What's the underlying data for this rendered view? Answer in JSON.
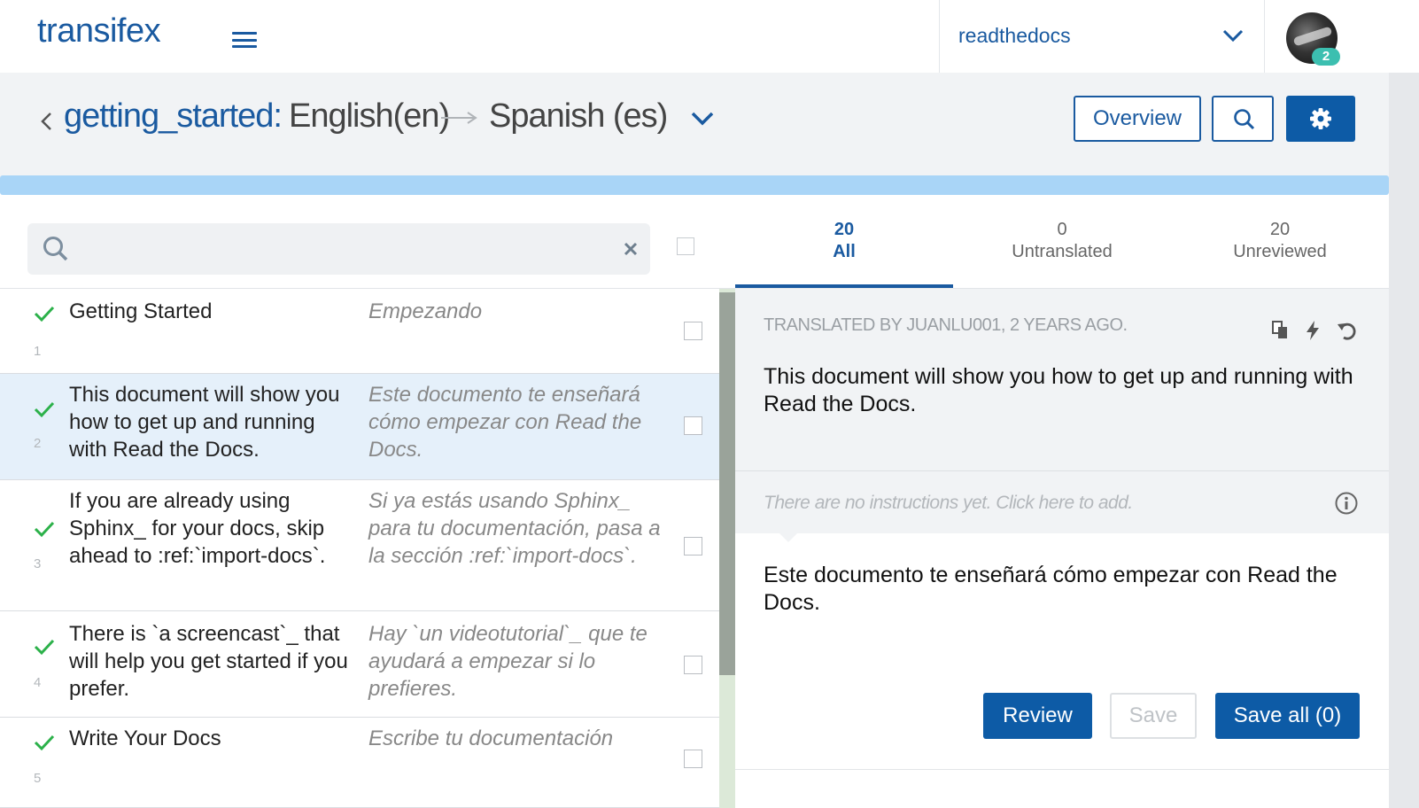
{
  "app": {
    "logo_text": "transifex"
  },
  "topbar": {
    "organization": "readthedocs",
    "notification_count": "2"
  },
  "header": {
    "project": "getting_started:",
    "source_language": "English(en)",
    "target_language": "Spanish (es)",
    "overview_label": "Overview"
  },
  "search": {
    "value": "",
    "placeholder": ""
  },
  "tabs": [
    {
      "count": "20",
      "label": "All",
      "active": true
    },
    {
      "count": "0",
      "label": "Untranslated",
      "active": false
    },
    {
      "count": "20",
      "label": "Unreviewed",
      "active": false
    }
  ],
  "strings": [
    {
      "num": "1",
      "source": "Getting Started",
      "translation": "Empezando",
      "status": "translated"
    },
    {
      "num": "2",
      "source": "This document will show you how to get up and running with Read the Docs.",
      "translation": "Este documento te enseñará cómo empezar con Read the Docs.",
      "status": "translated"
    },
    {
      "num": "3",
      "source": "If you are already using Sphinx_ for your docs, skip ahead to :ref:`import-docs`.",
      "translation": "Si ya estás usando Sphinx_ para tu documentación, pasa a la sección :ref:`import-docs`.",
      "status": "translated"
    },
    {
      "num": "4",
      "source": "There is `a screencast`_ that will help you get started if you prefer.",
      "translation": "Hay `un videotutorial`_ que te ayudará a empezar si lo prefieres.",
      "status": "translated"
    },
    {
      "num": "5",
      "source": "Write Your Docs",
      "translation": "Escribe tu documentación",
      "status": "translated"
    }
  ],
  "editor": {
    "translated_by": "TRANSLATED BY JUANLU001, 2 YEARS AGO.",
    "source_text": "This document will show you how to get up and running with Read the Docs.",
    "instructions_placeholder": "There are no instructions yet. Click here to add.",
    "translation_text": "Este documento te enseñará cómo empezar con Read the Docs.",
    "review_label": "Review",
    "save_label": "Save",
    "save_all_label": "Save all (0)"
  },
  "colors": {
    "brand": "#1a5aa0",
    "primary_button": "#0d5ba6",
    "check_green": "#2cb14a",
    "selected_row": "#e5f0fa",
    "progress": "#a9d5f7"
  },
  "icons": {
    "menu": "hamburger-icon",
    "org_dropdown": "chevron-down-icon",
    "back": "chevron-left-icon",
    "language_arrow": "arrow-right-icon",
    "search": "search-icon",
    "settings": "gear-icon",
    "clear": "close-icon",
    "status": "checkmark-icon",
    "copy": "copy-icon",
    "suggest": "bolt-icon",
    "undo": "undo-icon",
    "info": "info-icon"
  }
}
